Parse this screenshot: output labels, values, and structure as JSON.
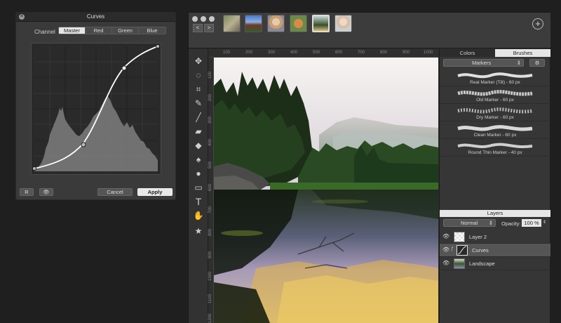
{
  "curves": {
    "title": "Curves",
    "channel_label": "Channel",
    "channels": [
      "Master",
      "Red",
      "Green",
      "Blue"
    ],
    "selected_channel": "Master",
    "reset_label": "R",
    "cancel_label": "Cancel",
    "apply_label": "Apply"
  },
  "toolbar": {
    "back_glyph": "<",
    "forward_glyph": ">",
    "add_glyph": "+"
  },
  "ruler": {
    "top": [
      "100",
      "200",
      "300",
      "400",
      "500",
      "600",
      "700",
      "800",
      "900",
      "1000"
    ],
    "left": [
      "100",
      "200",
      "300",
      "400",
      "500",
      "600",
      "700",
      "800",
      "900",
      "1000",
      "1100",
      "1200"
    ]
  },
  "panel": {
    "tabs": [
      "Colors",
      "Brushes"
    ],
    "active_tab": "Brushes",
    "brush_set": "Markers",
    "brushes": [
      "Real Marker (Tilt) - 60 px",
      "Old Marker - 60 px",
      "Dry Marker - 60 px",
      "Clean Marker - 60 px",
      "Round Thin Marker - 40 px"
    ]
  },
  "layers": {
    "header": "Layers",
    "blend_mode": "Normal",
    "opacity_label": "Opacity:",
    "opacity_value": "100 %",
    "items": [
      {
        "name": "Layer 2"
      },
      {
        "name": "Curves"
      },
      {
        "name": "Landscape"
      }
    ],
    "selected_index": 1
  },
  "icons": {
    "tools": [
      "move-icon",
      "ellipse-select-icon",
      "crop-icon",
      "eyedropper-icon",
      "brush-icon",
      "eraser-icon",
      "pencil-icon",
      "clone-stamp-icon",
      "drop-icon",
      "gradient-icon",
      "text-icon",
      "hand-icon",
      "star-icon"
    ]
  },
  "colors": {
    "panel_bg": "#3a3a3a",
    "active_tab": "#e6e6e6",
    "window_bg": "#2c2c2c"
  }
}
